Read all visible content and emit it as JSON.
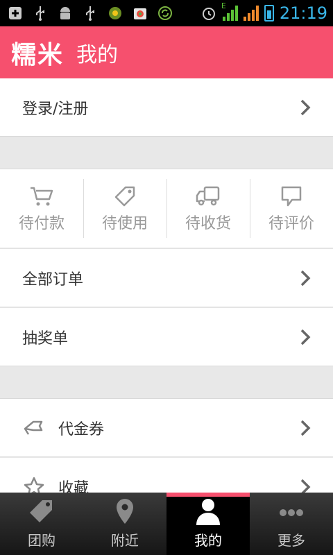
{
  "statusbar": {
    "time": "21:19",
    "network_label": "E"
  },
  "header": {
    "logo": "糯米",
    "title": "我的"
  },
  "login_row": {
    "label": "登录/注册"
  },
  "orders": [
    {
      "label": "待付款",
      "icon": "cart-icon"
    },
    {
      "label": "待使用",
      "icon": "tag-icon"
    },
    {
      "label": "待收货",
      "icon": "truck-icon"
    },
    {
      "label": "待评价",
      "icon": "comment-icon"
    }
  ],
  "rows": {
    "all_orders": "全部订单",
    "lottery": "抽奖单",
    "voucher": "代金券",
    "favorites": "收藏"
  },
  "tabbar": [
    {
      "label": "团购",
      "icon": "tag-icon"
    },
    {
      "label": "附近",
      "icon": "location-pin-icon"
    },
    {
      "label": "我的",
      "icon": "person-icon"
    },
    {
      "label": "更多",
      "icon": "more-dots-icon"
    }
  ],
  "colors": {
    "accent": "#f6506e",
    "status_time": "#39b6e8"
  }
}
